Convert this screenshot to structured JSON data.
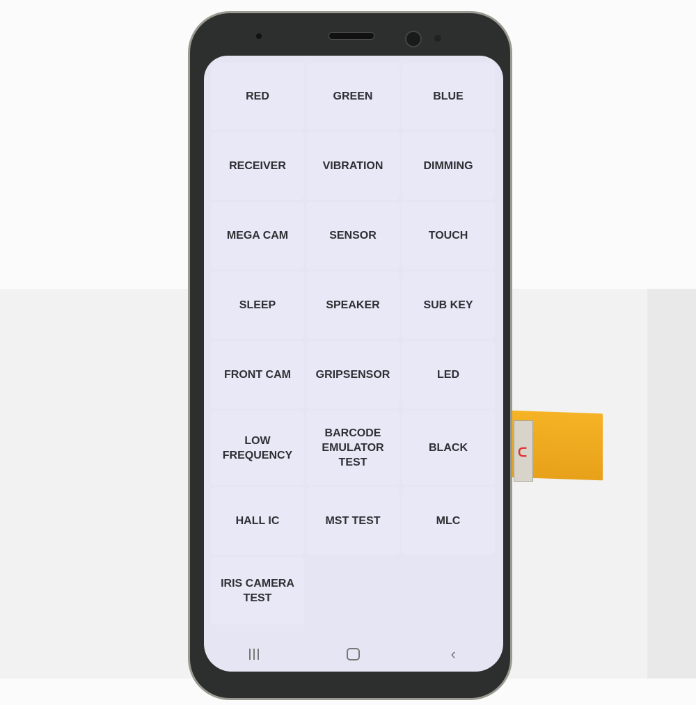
{
  "menu": {
    "items": [
      {
        "label": "RED"
      },
      {
        "label": "GREEN"
      },
      {
        "label": "BLUE"
      },
      {
        "label": "RECEIVER"
      },
      {
        "label": "VIBRATION"
      },
      {
        "label": "DIMMING"
      },
      {
        "label": "MEGA CAM"
      },
      {
        "label": "SENSOR"
      },
      {
        "label": "TOUCH"
      },
      {
        "label": "SLEEP"
      },
      {
        "label": "SPEAKER"
      },
      {
        "label": "SUB KEY"
      },
      {
        "label": "FRONT CAM"
      },
      {
        "label": "GRIPSENSOR"
      },
      {
        "label": "LED"
      },
      {
        "label": "LOW FREQUENCY"
      },
      {
        "label": "BARCODE\nEMULATOR TEST"
      },
      {
        "label": "BLACK"
      },
      {
        "label": "HALL IC"
      },
      {
        "label": "MST TEST"
      },
      {
        "label": "MLC"
      },
      {
        "label": "IRIS CAMERA\nTEST"
      }
    ]
  },
  "navbar": {
    "recents_icon": "recents-icon",
    "home_icon": "home-icon",
    "back_icon": "back-icon",
    "back_glyph": "‹"
  },
  "colors": {
    "screen": "#e6e5f3",
    "tile": "#e9e8f6",
    "text": "#2e2e33"
  }
}
